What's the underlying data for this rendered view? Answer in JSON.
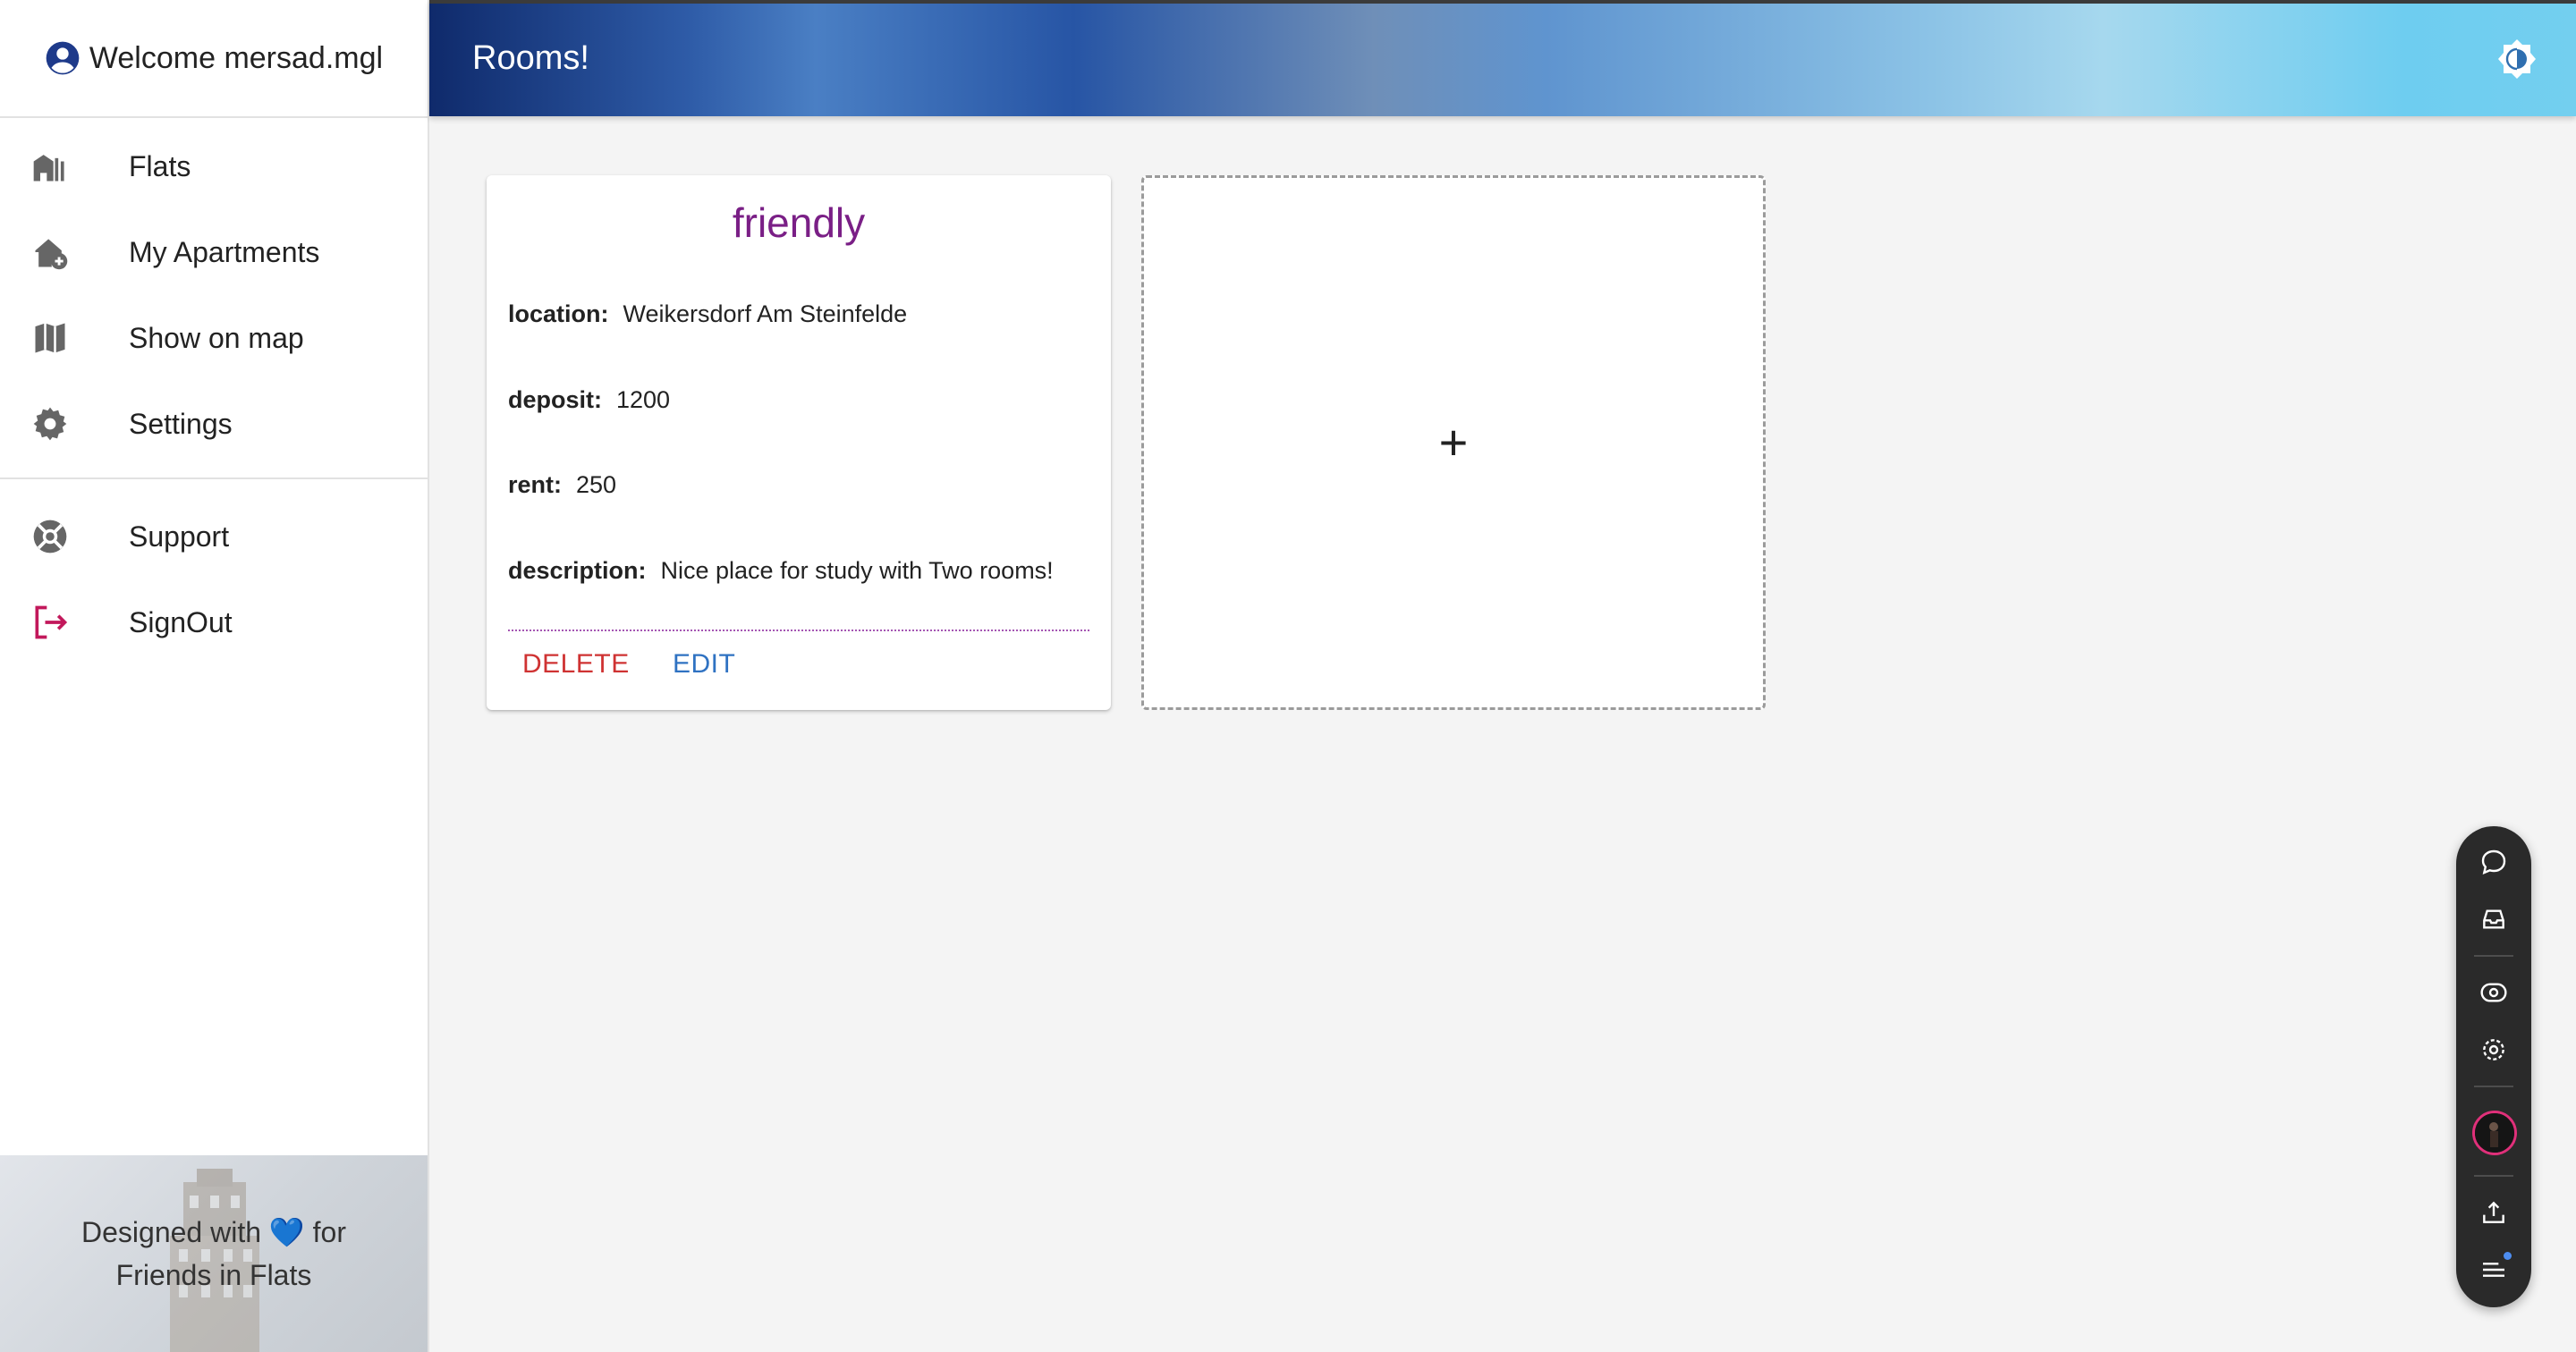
{
  "sidebar": {
    "welcome": "Welcome mersad.mgl",
    "items": [
      {
        "label": "Flats",
        "icon": "apartment-icon"
      },
      {
        "label": "My Apartments",
        "icon": "add-home-icon"
      },
      {
        "label": "Show on map",
        "icon": "map-icon"
      },
      {
        "label": "Settings",
        "icon": "gear-icon"
      }
    ],
    "secondary_items": [
      {
        "label": "Support",
        "icon": "lifebuoy-icon"
      },
      {
        "label": "SignOut",
        "icon": "signout-icon"
      }
    ],
    "footer_line1": "Designed with 💙 for",
    "footer_line2": "Friends in Flats"
  },
  "header": {
    "title": "Rooms!",
    "theme_toggle_icon": "brightness-icon"
  },
  "room_card": {
    "title": "friendly",
    "location_label": "location:",
    "location": "Weikersdorf Am Steinfelde",
    "deposit_label": "deposit:",
    "deposit": "1200",
    "rent_label": "rent:",
    "rent": "250",
    "description_label": "description:",
    "description": "Nice place for study with Two rooms!",
    "delete_label": "DELETE",
    "edit_label": "EDIT"
  },
  "add_card": {
    "symbol": "+"
  },
  "floating_toolbar": {
    "icons": [
      "chat-icon",
      "inbox-icon",
      "eye-icon",
      "settings-eye-icon",
      "user-avatar",
      "upload-icon",
      "menu-icon"
    ]
  },
  "colors": {
    "title_purple": "#7a1f86",
    "delete_red": "#cf3232",
    "edit_blue": "#2f72c2",
    "signout_red": "#c2185b",
    "avatar_blue": "#1e3a8a"
  }
}
